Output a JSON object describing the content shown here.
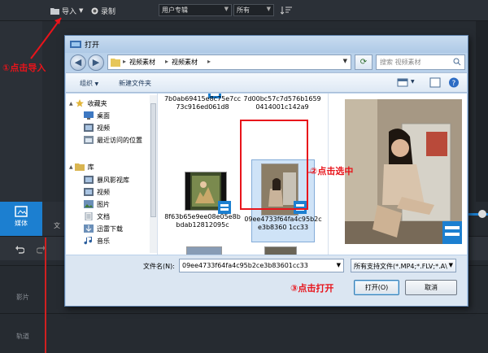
{
  "app": {
    "import_label": "导入",
    "record_label": "录制",
    "select_album": "用户专辑",
    "select_all": "所有",
    "media_tab": "媒体",
    "media_tab2": "文",
    "track1": "影片",
    "track2": "轨道"
  },
  "annotations": {
    "step1": "①点击导入",
    "step2": "②点击选中",
    "step3": "③点击打开"
  },
  "dialog": {
    "title": "打开",
    "breadcrumb": [
      "视频素材",
      "视频素材"
    ],
    "search_placeholder": "搜索 视频素材",
    "organize_label": "组织",
    "new_folder_label": "新建文件夹",
    "nav_items": [
      {
        "label": "收藏夹",
        "icon": "star-icon"
      },
      {
        "label": "桌面",
        "icon": "desktop-icon"
      },
      {
        "label": "视频",
        "icon": "video-library-icon"
      },
      {
        "label": "最近访问的位置",
        "icon": "recent-icon"
      },
      {
        "label": "库",
        "icon": "library-icon"
      },
      {
        "label": "暴风影视库",
        "icon": "video-library-icon"
      },
      {
        "label": "视频",
        "icon": "video-library-icon"
      },
      {
        "label": "图片",
        "icon": "pictures-icon"
      },
      {
        "label": "文档",
        "icon": "documents-icon"
      },
      {
        "label": "迅雷下载",
        "icon": "download-icon"
      },
      {
        "label": "音乐",
        "icon": "music-icon"
      }
    ],
    "files": {
      "top_left": "7b0ab69415e8c75e7cc73c916ed061d8",
      "top_right": "7d00bc57c7d576b16590414001c142a9",
      "mid_left": "8f63b65e9ee08e05e8bbdab12812095c",
      "mid_right": "09ee4733f64fa4c95b2ce3b8360 1cc33"
    },
    "filename_label": "文件名(N):",
    "filename_value": "09ee4733f64fa4c95b2ce3b83601cc33",
    "filetype_value": "所有支持文件(*.MP4;*.FLV;*.A\\",
    "open_label": "打开(O)",
    "cancel_label": "取消"
  },
  "colors": {
    "accent": "#1c7fd0",
    "annotation": "#e8141b"
  }
}
